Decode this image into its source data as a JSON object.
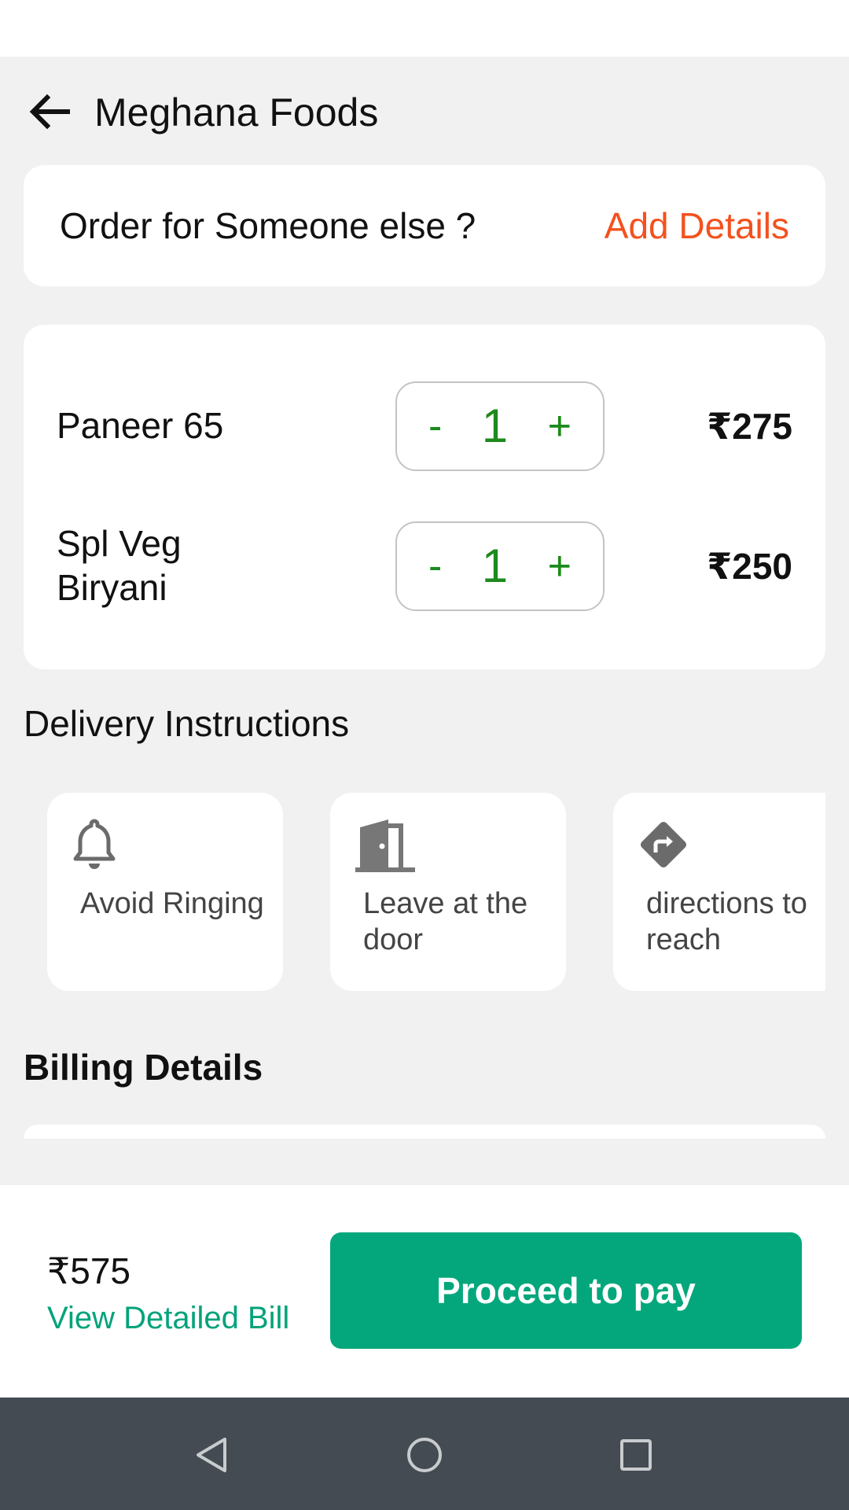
{
  "header": {
    "title": "Meghana Foods",
    "back_icon": "arrow-left-icon"
  },
  "someone_else": {
    "prompt": "Order for Someone else ?",
    "action": "Add Details",
    "action_color": "#f4511e"
  },
  "cart": {
    "items": [
      {
        "name": "Paneer 65",
        "minus": "-",
        "qty": "1",
        "plus": "+",
        "price": "₹275"
      },
      {
        "name": "Spl Veg Biryani",
        "minus": "-",
        "qty": "1",
        "plus": "+",
        "price": "₹250"
      }
    ],
    "stepper_color": "#1d8a1d"
  },
  "delivery": {
    "title": "Delivery Instructions",
    "options": [
      {
        "label": "Avoid Ringing",
        "icon": "bell-icon"
      },
      {
        "label": "Leave at the door",
        "icon": "door-icon"
      },
      {
        "label": "directions to reach",
        "icon": "directions-icon"
      }
    ]
  },
  "billing": {
    "title": "Billing Details"
  },
  "footer": {
    "total": "₹575",
    "view_bill": "View Detailed Bill",
    "pay_button": "Proceed to pay",
    "accent_color": "#03a77b"
  },
  "nav": {
    "back_icon": "nav-back-icon",
    "home_icon": "nav-home-icon",
    "recent_icon": "nav-recent-icon"
  }
}
